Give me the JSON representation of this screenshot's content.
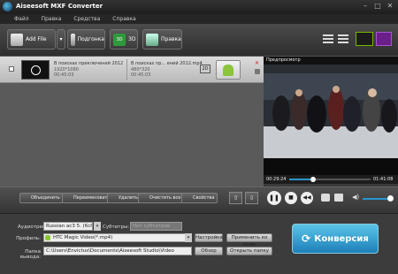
{
  "window": {
    "title": "Aiseesoft MXF Converter"
  },
  "menu": [
    "Файл",
    "Правка",
    "Средства",
    "Справка"
  ],
  "toolbar": {
    "add_file": "Add File",
    "clip": "Подгонка",
    "3d": "3D",
    "edit": "Правка"
  },
  "file": {
    "source_title": "В поисках приключений 2012",
    "source_res": "1920*1080",
    "source_time": "00:45:03",
    "output_title": "В поисках пр... ений 2012.mp4",
    "output_res": "480*320",
    "output_time": "00:45:03",
    "badge_2d": "2D"
  },
  "preview": {
    "label": "Предпросмотр",
    "time_current": "00:29:24",
    "time_total": "01:41:08",
    "progress": 0.29
  },
  "actions": {
    "merge": "Объединить",
    "rename": "Переименовать",
    "delete": "Удалить",
    "clear_all": "Очистить все",
    "properties": "Свойства"
  },
  "settings": {
    "audio_label": "Аудиотрек:",
    "audio_value": "Russian ac3 5. (6ch) 8",
    "subtitles_label": "Субтитры:",
    "subtitles_value": "Нет субтитров",
    "profile_label": "Профиль:",
    "profile_value": "HTC Magic Video(*.mp4)",
    "settings_button": "Настройка",
    "apply_all_button": "Применить ко всем",
    "output_label": "Папка вывода:",
    "output_path": "C:\\Users\\Envictus\\Documents\\Aiseesoft Studio\\Video",
    "browse_button": "Обзор",
    "open_folder_button": "Открыть папку",
    "convert_button": "Конверсия"
  },
  "colors": {
    "accent": "#2a96cc",
    "toolbar_3d": "#2e9a3a"
  }
}
